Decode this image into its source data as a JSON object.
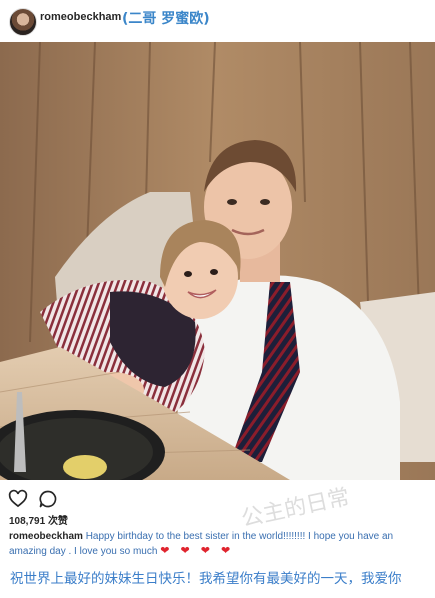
{
  "header": {
    "username": "romeobeckham",
    "caption_cn": "(二哥 罗蜜欧)"
  },
  "post": {
    "photo_alt": "",
    "likes_count": "108,791",
    "likes_label": "次赞",
    "caption_user": "romeobeckham",
    "caption_text": "Happy birthday to the best sister in the world!!!!!!!! I hope you have an amazing day . I love you so much",
    "caption_hearts": "❤ ❤ ❤ ❤",
    "translation": "祝世界上最好的妹妹生日快乐！我希望你有最美好的一天，我爱你",
    "watermark": "公主的日常"
  },
  "icons": {
    "like": "heart-outline-icon",
    "comment": "comment-bubble-icon"
  },
  "colors": {
    "link_blue": "#3b86c9",
    "heart_red": "#e0242e",
    "text_dark": "#262626"
  }
}
